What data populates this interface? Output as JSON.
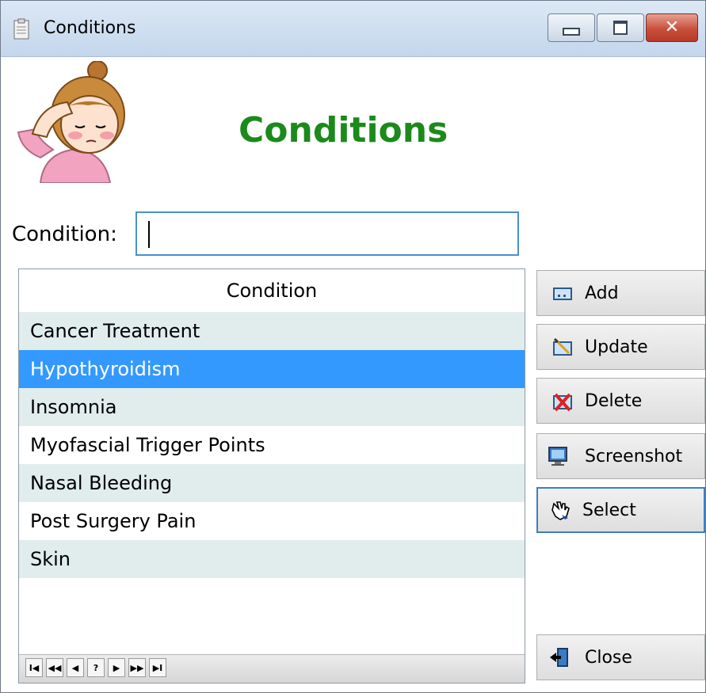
{
  "window": {
    "title": "Conditions",
    "controls": {
      "minimize": "minimize",
      "maximize": "maximize",
      "close": "✕"
    }
  },
  "form": {
    "heading": "Conditions",
    "condition_label": "Condition:",
    "condition_value": ""
  },
  "grid": {
    "header": "Condition",
    "rows": [
      "Cancer Treatment",
      "Hypothyroidism",
      "Insomnia",
      "Myofascial Trigger Points",
      "Nasal Bleeding",
      "Post Surgery Pain",
      "Skin"
    ],
    "selected_index": 1,
    "navigator": [
      "I◀",
      "◀◀",
      "◀",
      "?",
      "▶",
      "▶▶",
      "▶I"
    ]
  },
  "buttons": {
    "add": "Add",
    "update": "Update",
    "delete": "Delete",
    "screenshot": "Screenshot",
    "select": "Select",
    "close": "Close"
  },
  "icons": {
    "add": "add-record-icon",
    "update": "update-record-icon",
    "delete": "delete-record-icon",
    "screenshot": "screenshot-icon",
    "select": "hand-pointer-icon",
    "close": "exit-door-icon"
  },
  "colors": {
    "heading": "#1b8a1b",
    "selection": "#3399ff",
    "alt_row": "#e1eded",
    "focus": "#3c7fc4"
  }
}
